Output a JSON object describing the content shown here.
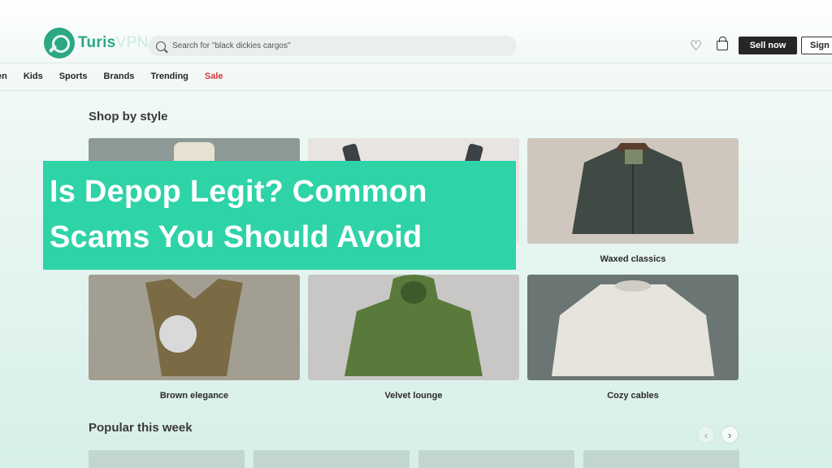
{
  "header": {
    "logo_brand": "Turis",
    "logo_suffix": "VPN",
    "search_placeholder": "Search for \"black dickies cargos\"",
    "sell_label": "Sell now",
    "signin_label": "Sign"
  },
  "nav": {
    "items": [
      "en",
      "Kids",
      "Sports",
      "Brands",
      "Trending",
      "Sale"
    ]
  },
  "shop": {
    "title": "Shop by style",
    "tiles": [
      {
        "label": ""
      },
      {
        "label": ""
      },
      {
        "label": "Waxed classics"
      },
      {
        "label": "Brown elegance"
      },
      {
        "label": "Velvet lounge"
      },
      {
        "label": "Cozy cables"
      }
    ]
  },
  "banner": {
    "line1": "Is Depop Legit? Common",
    "line2": "Scams You Should Avoid"
  },
  "popular": {
    "title": "Popular this week",
    "prev": "‹",
    "next": "›"
  },
  "colors": {
    "accent": "#2ed3a8",
    "logo": "#2ba783",
    "sale": "#d8343f"
  }
}
